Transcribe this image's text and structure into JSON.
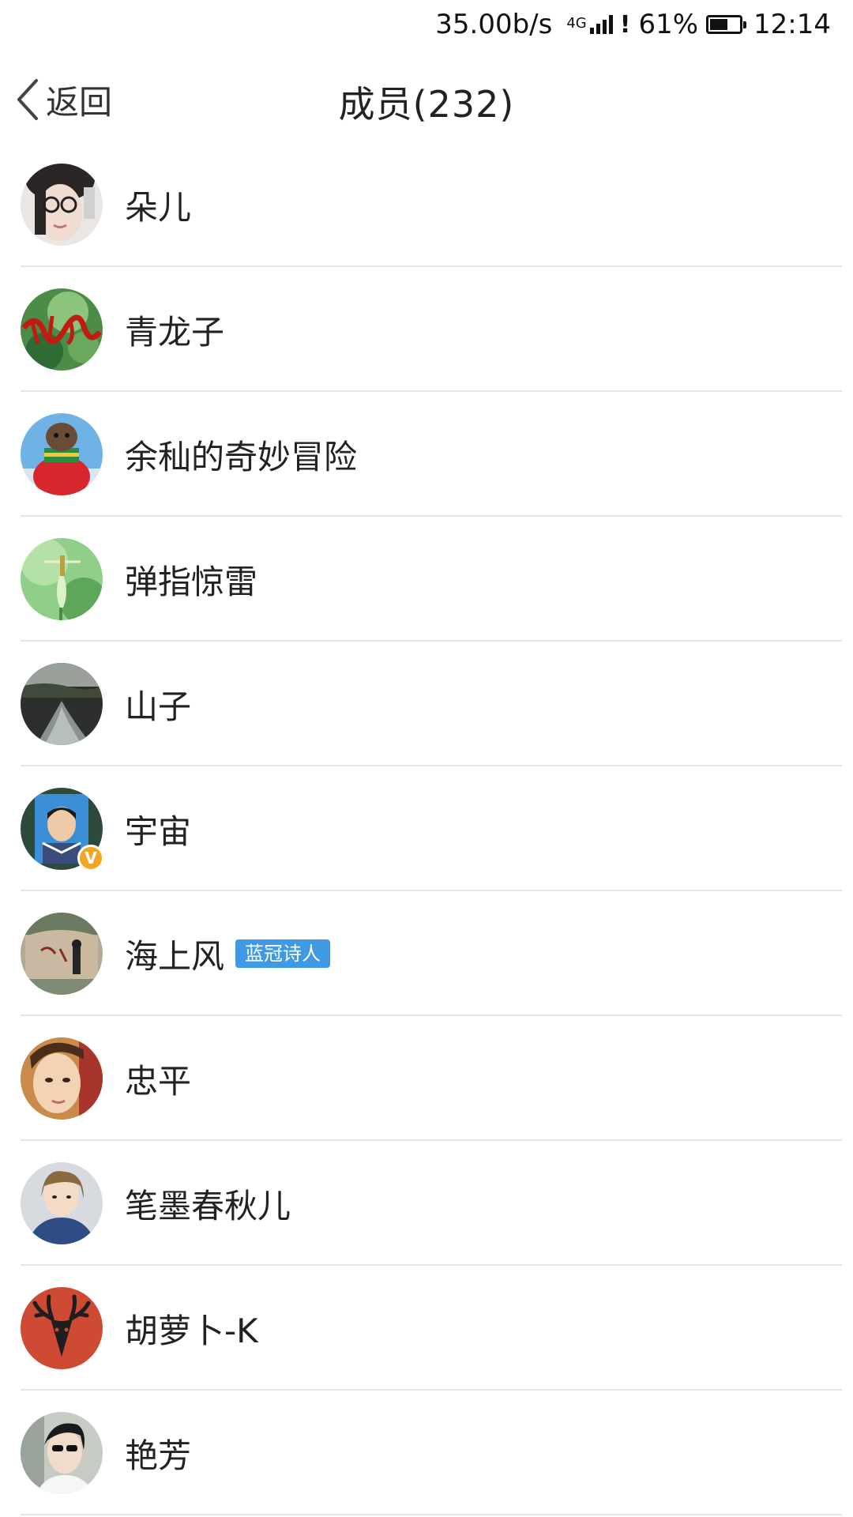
{
  "status_bar": {
    "speed": "35.00b/s",
    "network": "4G",
    "battery_percent": "61%",
    "battery_level": 0.61,
    "time": "12:14"
  },
  "nav": {
    "back_label": "返回",
    "title": "成员(232)"
  },
  "colors": {
    "tag_bg": "#3f9ae3",
    "verify_badge": "#f4a623",
    "divider": "#e4e4e4"
  },
  "members": [
    {
      "name": "朵儿",
      "avatar": "woman-glasses-photo"
    },
    {
      "name": "青龙子",
      "avatar": "green-calligraphy-photo"
    },
    {
      "name": "余秈的奇妙冒险",
      "avatar": "dog-in-red-sweater-photo"
    },
    {
      "name": "弹指惊雷",
      "avatar": "dragonfly-lotus-photo"
    },
    {
      "name": "山子",
      "avatar": "river-landscape-photo"
    },
    {
      "name": "宇宙",
      "avatar": "boy-portrait-photo",
      "verified": true,
      "badge_text": "V"
    },
    {
      "name": "海上风",
      "avatar": "stone-monument-photo",
      "tag": "蓝冠诗人"
    },
    {
      "name": "忠平",
      "avatar": "girl-selfie-photo"
    },
    {
      "name": "笔墨春秋儿",
      "avatar": "girl-denim-photo"
    },
    {
      "name": "胡萝卜-K",
      "avatar": "deer-head-logo"
    },
    {
      "name": "艳芳",
      "avatar": "person-sunglasses-photo"
    }
  ]
}
